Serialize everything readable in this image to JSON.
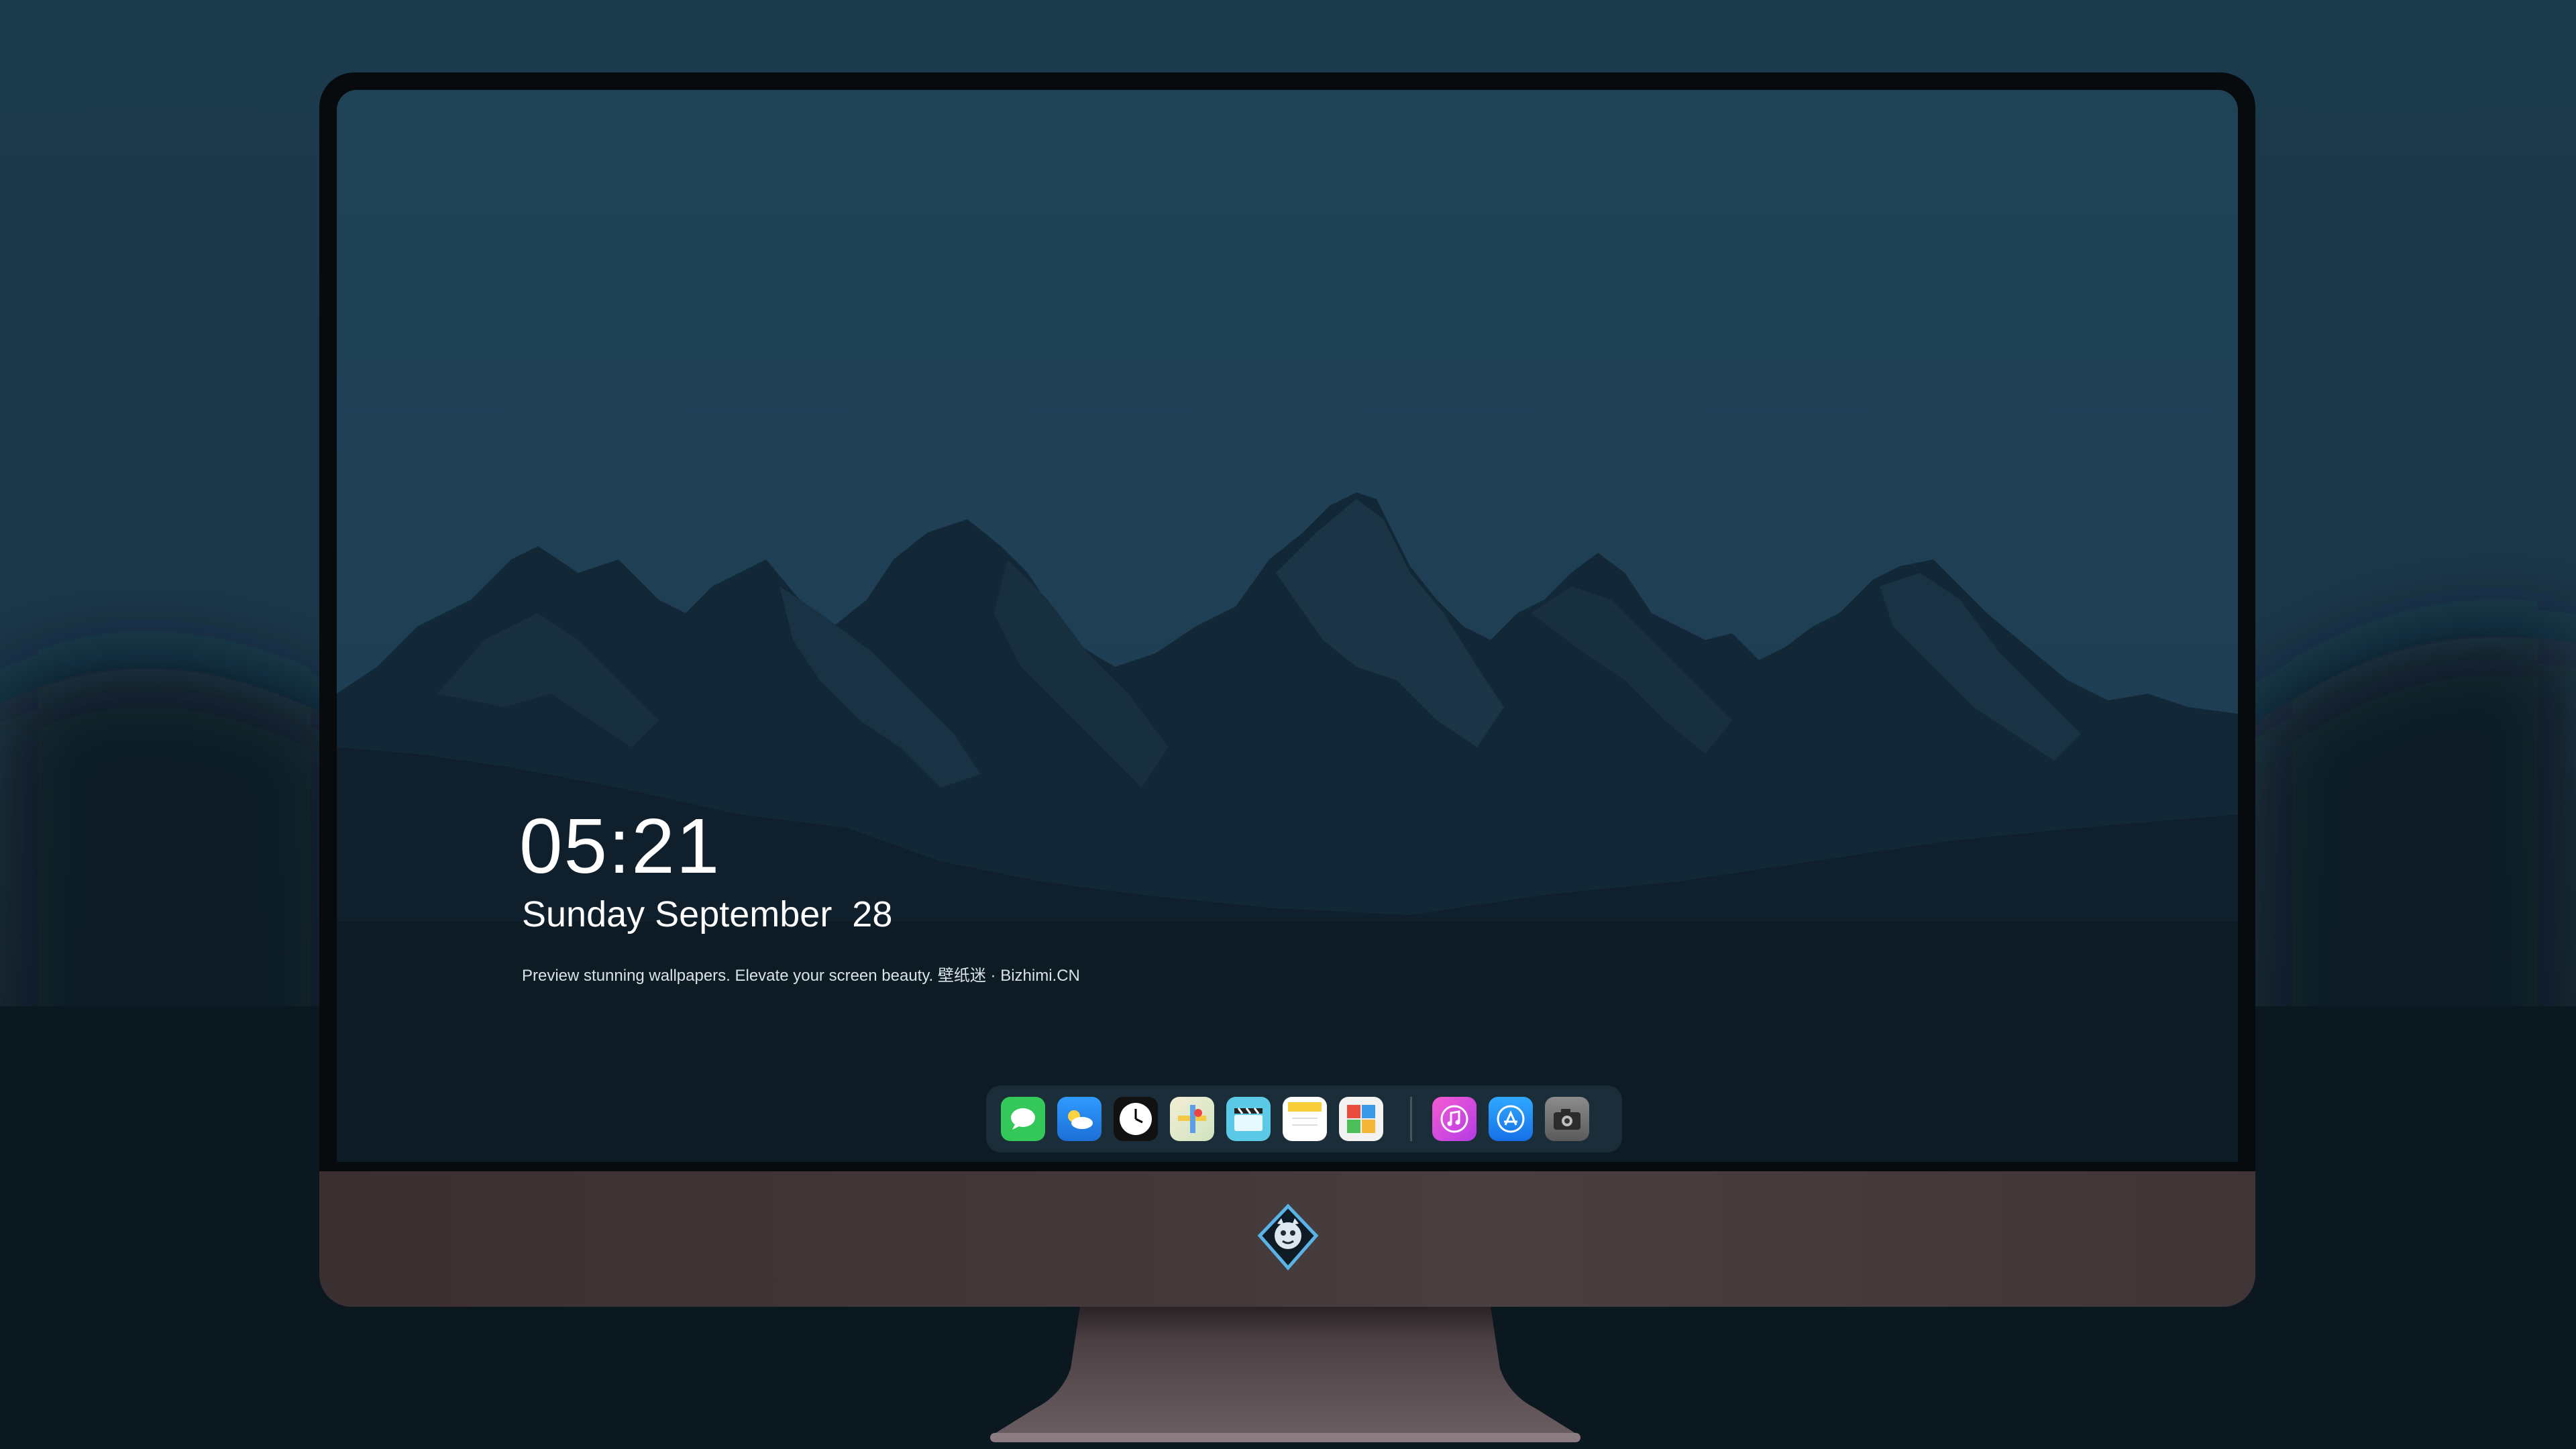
{
  "lockscreen": {
    "time": "05:21",
    "date": "Sunday September  28",
    "tagline": "Preview stunning wallpapers. Elevate your screen beauty. 壁纸迷 · Bizhimi.CN"
  },
  "dock": {
    "apps": [
      {
        "icon": "messages-icon",
        "color": "#34c759"
      },
      {
        "icon": "weather-icon",
        "color": "#2b8ef0"
      },
      {
        "icon": "clock-icon",
        "color": "#1b1b1b"
      },
      {
        "icon": "maps-icon",
        "color": "#e9e4cc"
      },
      {
        "icon": "clips-icon",
        "color": "#5bc8e8"
      },
      {
        "icon": "notes-icon",
        "color": "#f9d34a"
      },
      {
        "icon": "photo-booth-icon",
        "color": "#e9e9e9"
      },
      {
        "icon": "itunes-icon",
        "color": "#d44de0"
      },
      {
        "icon": "app-store-icon",
        "color": "#1f8ef7"
      },
      {
        "icon": "camera-icon",
        "color": "#6f6f6f"
      }
    ]
  },
  "colors": {
    "sky": "#1f4257",
    "mountains_far": "#17303f",
    "mountains_near": "#0e1c27",
    "chin": "#43393b"
  }
}
